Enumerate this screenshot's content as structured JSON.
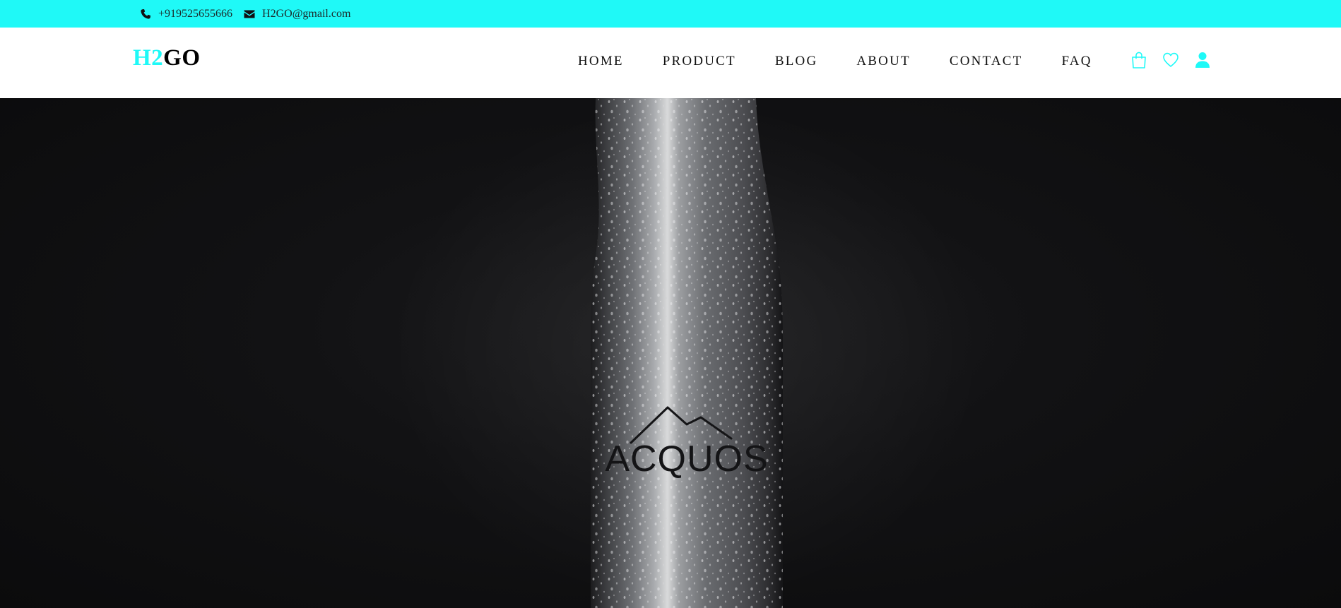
{
  "topbar": {
    "phone": "+919525655666",
    "email": "H2GO@gmail.com",
    "background_color": "#1ff9f7"
  },
  "brand": {
    "part1": "H2",
    "part2": "GO",
    "accent_color": "#1ff9f7"
  },
  "nav": {
    "items": [
      {
        "label": "HOME"
      },
      {
        "label": "PRODUCT"
      },
      {
        "label": "BLOG"
      },
      {
        "label": "ABOUT"
      },
      {
        "label": "CONTACT"
      },
      {
        "label": "FAQ"
      }
    ]
  },
  "header_icons": [
    "shopping-bag-icon",
    "heart-icon",
    "user-icon"
  ],
  "hero": {
    "bottle_brand": "ACQUOS",
    "background_color": "#0e0e10"
  }
}
